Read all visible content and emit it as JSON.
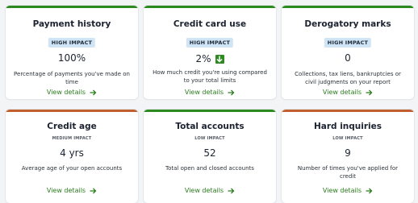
{
  "colors": {
    "high_impact_stripe": "#2b8a1e",
    "medium_impact_stripe": "#c0602e",
    "badge_background": "#cfe4f5",
    "link": "#2a7d1d",
    "down_indicator": "#2e8a21"
  },
  "cards": [
    {
      "title": "Payment history",
      "impact": "HIGH IMPACT",
      "value": "100%",
      "description": "Percentage of payments you've made on time",
      "link": "View details",
      "link_icon": "arrow-right-icon"
    },
    {
      "title": "Credit card use",
      "impact": "HIGH IMPACT",
      "value": "2%",
      "value_icon": "arrow-down-icon",
      "description": "How much credit you're using compared to your total limits",
      "link": "View details",
      "link_icon": "arrow-right-icon"
    },
    {
      "title": "Derogatory marks",
      "impact": "HIGH IMPACT",
      "value": "0",
      "description": "Collections, tax liens, bankruptcies or civil judgments on your report",
      "link": "View details",
      "link_icon": "arrow-right-icon"
    },
    {
      "title": "Credit age",
      "impact": "MEDIUM IMPACT",
      "value": "4 yrs",
      "description": "Average age of your open accounts",
      "link": "View details",
      "link_icon": "arrow-right-icon"
    },
    {
      "title": "Total accounts",
      "impact": "LOW IMPACT",
      "value": "52",
      "description": "Total open and closed accounts",
      "link": "View details",
      "link_icon": "arrow-right-icon"
    },
    {
      "title": "Hard inquiries",
      "impact": "LOW IMPACT",
      "value": "9",
      "description": "Number of times you've applied for credit",
      "link": "View details",
      "link_icon": "arrow-right-icon"
    }
  ]
}
